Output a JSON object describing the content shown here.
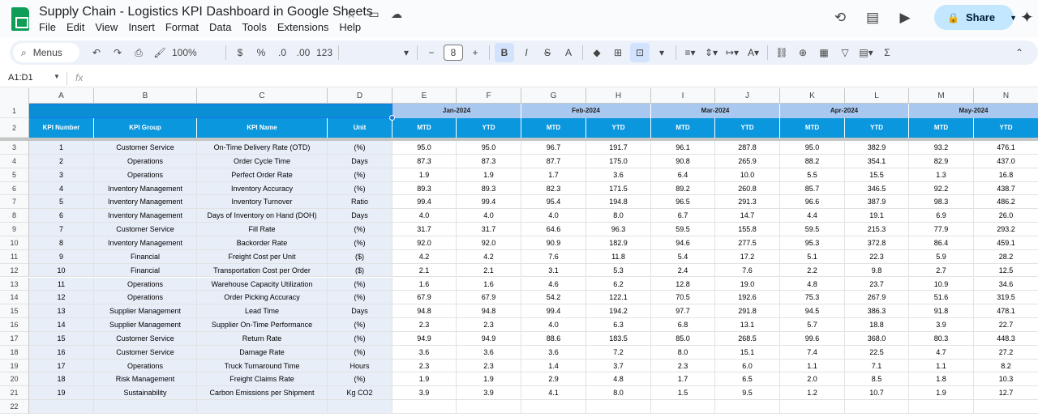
{
  "app": {
    "title": "Supply Chain - Logistics KPI Dashboard in Google Sheets",
    "menu": [
      "File",
      "Edit",
      "View",
      "Insert",
      "Format",
      "Data",
      "Tools",
      "Extensions",
      "Help"
    ],
    "share_label": "Share"
  },
  "toolbar": {
    "search_label": "Menus",
    "zoom": "100%",
    "currency": "$",
    "percent": "%",
    "decrease_decimal": ".0",
    "increase_decimal": ".00",
    "number_format": "123",
    "font_size": "8"
  },
  "formula_bar": {
    "name_box": "A1:D1",
    "fx": "fx"
  },
  "columns": [
    "A",
    "B",
    "C",
    "D",
    "E",
    "F",
    "G",
    "H",
    "I",
    "J",
    "K",
    "L",
    "M",
    "N"
  ],
  "row_numbers": [
    "1",
    "2",
    "3",
    "4",
    "5",
    "6",
    "7",
    "8",
    "9",
    "10",
    "11",
    "12",
    "13",
    "14",
    "15",
    "16",
    "17",
    "18",
    "19",
    "20",
    "21",
    "22"
  ],
  "months": [
    "Jan-2024",
    "Feb-2024",
    "Mar-2024",
    "Apr-2024",
    "May-2024"
  ],
  "headers": [
    "KPI Number",
    "KPI Group",
    "KPI Name",
    "Unit",
    "MTD",
    "YTD",
    "MTD",
    "YTD",
    "MTD",
    "YTD",
    "MTD",
    "YTD",
    "MTD",
    "YTD"
  ],
  "rows": [
    [
      "1",
      "Customer Service",
      "On-Time Delivery Rate (OTD)",
      "(%)",
      "95.0",
      "95.0",
      "96.7",
      "191.7",
      "96.1",
      "287.8",
      "95.0",
      "382.9",
      "93.2",
      "476.1"
    ],
    [
      "2",
      "Operations",
      "Order Cycle Time",
      "Days",
      "87.3",
      "87.3",
      "87.7",
      "175.0",
      "90.8",
      "265.9",
      "88.2",
      "354.1",
      "82.9",
      "437.0"
    ],
    [
      "3",
      "Operations",
      "Perfect Order Rate",
      "(%)",
      "1.9",
      "1.9",
      "1.7",
      "3.6",
      "6.4",
      "10.0",
      "5.5",
      "15.5",
      "1.3",
      "16.8"
    ],
    [
      "4",
      "Inventory Management",
      "Inventory Accuracy",
      "(%)",
      "89.3",
      "89.3",
      "82.3",
      "171.5",
      "89.2",
      "260.8",
      "85.7",
      "346.5",
      "92.2",
      "438.7"
    ],
    [
      "5",
      "Inventory Management",
      "Inventory Turnover",
      "Ratio",
      "99.4",
      "99.4",
      "95.4",
      "194.8",
      "96.5",
      "291.3",
      "96.6",
      "387.9",
      "98.3",
      "486.2"
    ],
    [
      "6",
      "Inventory Management",
      "Days of Inventory on Hand (DOH)",
      "Days",
      "4.0",
      "4.0",
      "4.0",
      "8.0",
      "6.7",
      "14.7",
      "4.4",
      "19.1",
      "6.9",
      "26.0"
    ],
    [
      "7",
      "Customer Service",
      "Fill Rate",
      "(%)",
      "31.7",
      "31.7",
      "64.6",
      "96.3",
      "59.5",
      "155.8",
      "59.5",
      "215.3",
      "77.9",
      "293.2"
    ],
    [
      "8",
      "Inventory Management",
      "Backorder Rate",
      "(%)",
      "92.0",
      "92.0",
      "90.9",
      "182.9",
      "94.6",
      "277.5",
      "95.3",
      "372.8",
      "86.4",
      "459.1"
    ],
    [
      "9",
      "Financial",
      "Freight Cost per Unit",
      "($)",
      "4.2",
      "4.2",
      "7.6",
      "11.8",
      "5.4",
      "17.2",
      "5.1",
      "22.3",
      "5.9",
      "28.2"
    ],
    [
      "10",
      "Financial",
      "Transportation Cost per Order",
      "($)",
      "2.1",
      "2.1",
      "3.1",
      "5.3",
      "2.4",
      "7.6",
      "2.2",
      "9.8",
      "2.7",
      "12.5"
    ],
    [
      "11",
      "Operations",
      "Warehouse Capacity Utilization",
      "(%)",
      "1.6",
      "1.6",
      "4.6",
      "6.2",
      "12.8",
      "19.0",
      "4.8",
      "23.7",
      "10.9",
      "34.6"
    ],
    [
      "12",
      "Operations",
      "Order Picking Accuracy",
      "(%)",
      "67.9",
      "67.9",
      "54.2",
      "122.1",
      "70.5",
      "192.6",
      "75.3",
      "267.9",
      "51.6",
      "319.5"
    ],
    [
      "13",
      "Supplier Management",
      "Lead Time",
      "Days",
      "94.8",
      "94.8",
      "99.4",
      "194.2",
      "97.7",
      "291.8",
      "94.5",
      "386.3",
      "91.8",
      "478.1"
    ],
    [
      "14",
      "Supplier Management",
      "Supplier On-Time Performance",
      "(%)",
      "2.3",
      "2.3",
      "4.0",
      "6.3",
      "6.8",
      "13.1",
      "5.7",
      "18.8",
      "3.9",
      "22.7"
    ],
    [
      "15",
      "Customer Service",
      "Return Rate",
      "(%)",
      "94.9",
      "94.9",
      "88.6",
      "183.5",
      "85.0",
      "268.5",
      "99.6",
      "368.0",
      "80.3",
      "448.3"
    ],
    [
      "16",
      "Customer Service",
      "Damage Rate",
      "(%)",
      "3.6",
      "3.6",
      "3.6",
      "7.2",
      "8.0",
      "15.1",
      "7.4",
      "22.5",
      "4.7",
      "27.2"
    ],
    [
      "17",
      "Operations",
      "Truck Turnaround Time",
      "Hours",
      "2.3",
      "2.3",
      "1.4",
      "3.7",
      "2.3",
      "6.0",
      "1.1",
      "7.1",
      "1.1",
      "8.2"
    ],
    [
      "18",
      "Risk Management",
      "Freight Claims Rate",
      "(%)",
      "1.9",
      "1.9",
      "2.9",
      "4.8",
      "1.7",
      "6.5",
      "2.0",
      "8.5",
      "1.8",
      "10.3"
    ],
    [
      "19",
      "Sustainability",
      "Carbon Emissions per Shipment",
      "Kg CO2",
      "3.9",
      "3.9",
      "4.1",
      "8.0",
      "1.5",
      "9.5",
      "1.2",
      "10.7",
      "1.9",
      "12.7"
    ]
  ],
  "colors": {
    "header_blue": "#0a97de",
    "month_band": "#a9c8ef",
    "left_col_fill": "#e8eef8"
  }
}
